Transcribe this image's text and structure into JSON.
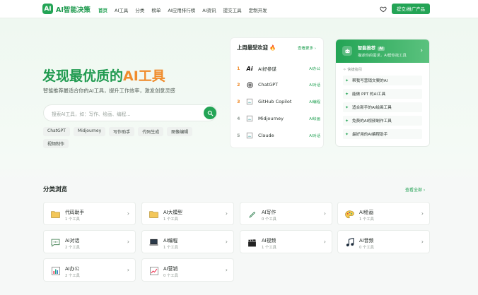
{
  "brand": {
    "logo_mark": "AI",
    "name": "AI智能决策"
  },
  "nav": {
    "links": [
      "首页",
      "AI工具",
      "分类",
      "榜单",
      "AI应用排行榜",
      "AI资讯",
      "提交工具",
      "定制开发"
    ],
    "active_index": 0,
    "submit_label": "提交/推广产品"
  },
  "hero": {
    "title_main": "发现最优质的",
    "title_accent": "AI工具",
    "subtitle": "智能推荐最适合你的AI工具，提升工作效率，激发创意灵感",
    "search_placeholder": "搜索AI工具，如：写作、绘画、编程...",
    "tags": [
      "ChatGPT",
      "Midjourney",
      "写作助手",
      "代码生成",
      "图像编辑",
      "视频制作"
    ]
  },
  "ranking": {
    "title": "上周最受欢迎 🔥",
    "more": "查看更多 ›",
    "items": [
      {
        "rank": "1",
        "name": "AI好参谋",
        "category": "AI办公",
        "logo": "ai-logo"
      },
      {
        "rank": "2",
        "name": "ChatGPT",
        "category": "AI对话",
        "logo": "openai-logo"
      },
      {
        "rank": "3",
        "name": "GitHub Copilot",
        "category": "AI编程",
        "logo": "broken-image-icon"
      },
      {
        "rank": "4",
        "name": "Midjourney",
        "category": "AI绘画",
        "logo": "broken-image-icon"
      },
      {
        "rank": "5",
        "name": "Claude",
        "category": "AI对话",
        "logo": "broken-image-icon"
      }
    ]
  },
  "smart": {
    "title": "智能推荐",
    "badge": "AI",
    "desc": "描述你的需求，AI帮你找工具",
    "quick_label": "✧ 快捷指引",
    "quick_items": [
      "帮我写营销文案的AI",
      "能做 PPT 的AI工具",
      "适合新手的AI绘画工具",
      "免费的AI视频制作工具",
      "最好用的AI编程助手"
    ]
  },
  "categories": {
    "title": "分类浏览",
    "more": "查看全部",
    "items": [
      {
        "name": "代码助手",
        "count": "1 个工具",
        "icon": "folder-icon"
      },
      {
        "name": "AI大模型",
        "count": "1 个工具",
        "icon": "folder-icon"
      },
      {
        "name": "AI写作",
        "count": "0 个工具",
        "icon": "pen-icon"
      },
      {
        "name": "AI绘画",
        "count": "1 个工具",
        "icon": "palette-icon"
      },
      {
        "name": "AI对话",
        "count": "2 个工具",
        "icon": "chat-icon"
      },
      {
        "name": "AI编程",
        "count": "1 个工具",
        "icon": "laptop-icon"
      },
      {
        "name": "AI视频",
        "count": "1 个工具",
        "icon": "clapper-icon"
      },
      {
        "name": "AI音频",
        "count": "0 个工具",
        "icon": "music-icon"
      },
      {
        "name": "AI办公",
        "count": "2 个工具",
        "icon": "chart-bar-icon"
      },
      {
        "name": "AI营销",
        "count": "0 个工具",
        "icon": "chart-line-icon"
      }
    ]
  },
  "colors": {
    "brand_green": "#23a455",
    "accent_orange": "#f08c2c"
  }
}
